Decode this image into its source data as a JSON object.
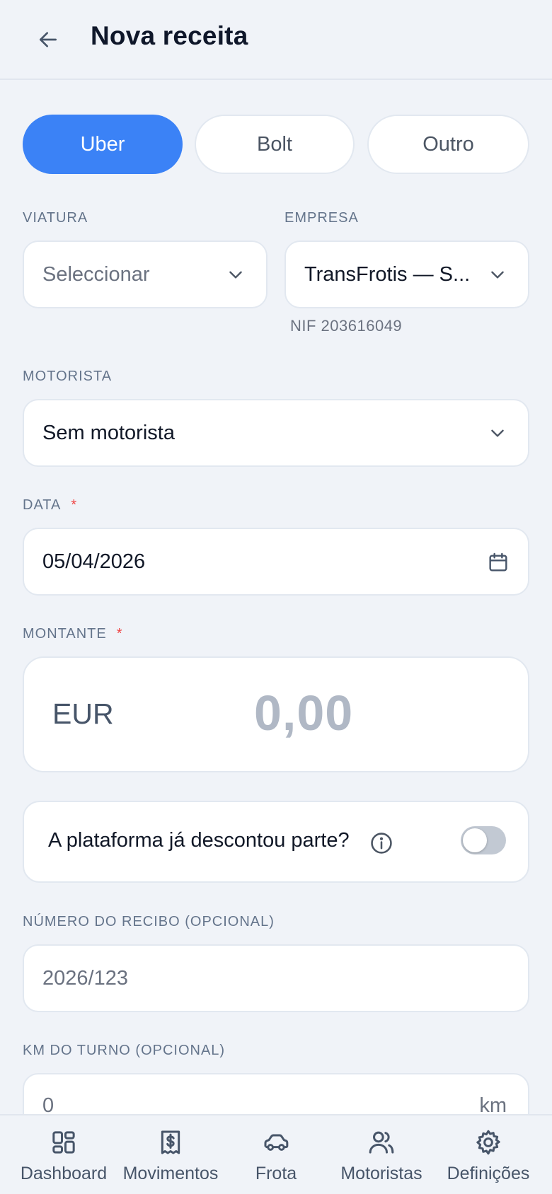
{
  "header": {
    "title": "Nova receita",
    "back_icon": "arrow-left-icon"
  },
  "platforms": {
    "options": [
      "Uber",
      "Bolt",
      "Outro"
    ],
    "selected": "Uber",
    "accent_color": "#3b82f6"
  },
  "viatura": {
    "label": "VIATURA",
    "placeholder": "Seleccionar"
  },
  "empresa": {
    "label": "EMPRESA",
    "value": "TransFrotis — S...",
    "nif": "NIF 203616049"
  },
  "motorista": {
    "label": "MOTORISTA",
    "value": "Sem motorista"
  },
  "data": {
    "label": "DATA",
    "required_mark": "*",
    "value": "05/04/2026"
  },
  "montante": {
    "label": "MONTANTE",
    "required_mark": "*",
    "currency": "EUR",
    "placeholder": "0,00"
  },
  "discount": {
    "label": "A plataforma já descontou parte?",
    "enabled": false
  },
  "recibo": {
    "label": "NÚMERO DO RECIBO (OPCIONAL)",
    "placeholder": "2026/123"
  },
  "km": {
    "label": "KM DO TURNO (OPCIONAL)",
    "placeholder": "0",
    "unit": "km"
  },
  "nav": {
    "items": [
      {
        "label": "Dashboard",
        "icon": "dashboard-icon"
      },
      {
        "label": "Movimentos",
        "icon": "receipt-icon"
      },
      {
        "label": "Frota",
        "icon": "car-icon"
      },
      {
        "label": "Motoristas",
        "icon": "users-icon"
      },
      {
        "label": "Definições",
        "icon": "gear-icon"
      }
    ]
  }
}
